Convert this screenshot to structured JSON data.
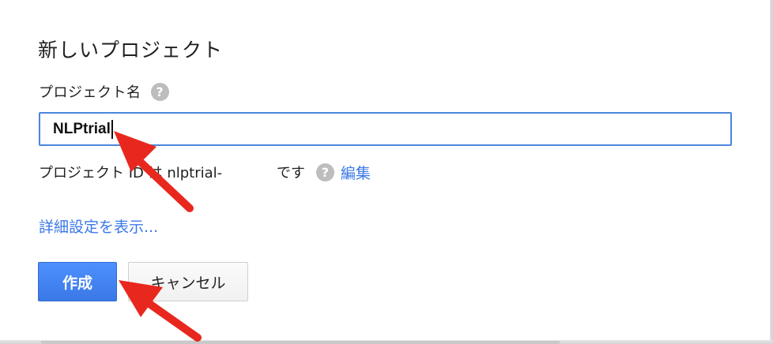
{
  "dialog": {
    "title": "新しいプロジェクト",
    "project_name_label": "プロジェクト名",
    "help_icon": "question-circle-icon",
    "project_name_value": "NLPtrial",
    "project_id_text": "プロジェクト ID は nlptrial-            です",
    "edit_link": "編集",
    "advanced_link": "詳細設定を表示...",
    "create_button": "作成",
    "cancel_button": "キャンセル"
  },
  "annotations": {
    "arrow_color": "#e8281e",
    "arrow_icon": "red-arrow-annotation"
  }
}
